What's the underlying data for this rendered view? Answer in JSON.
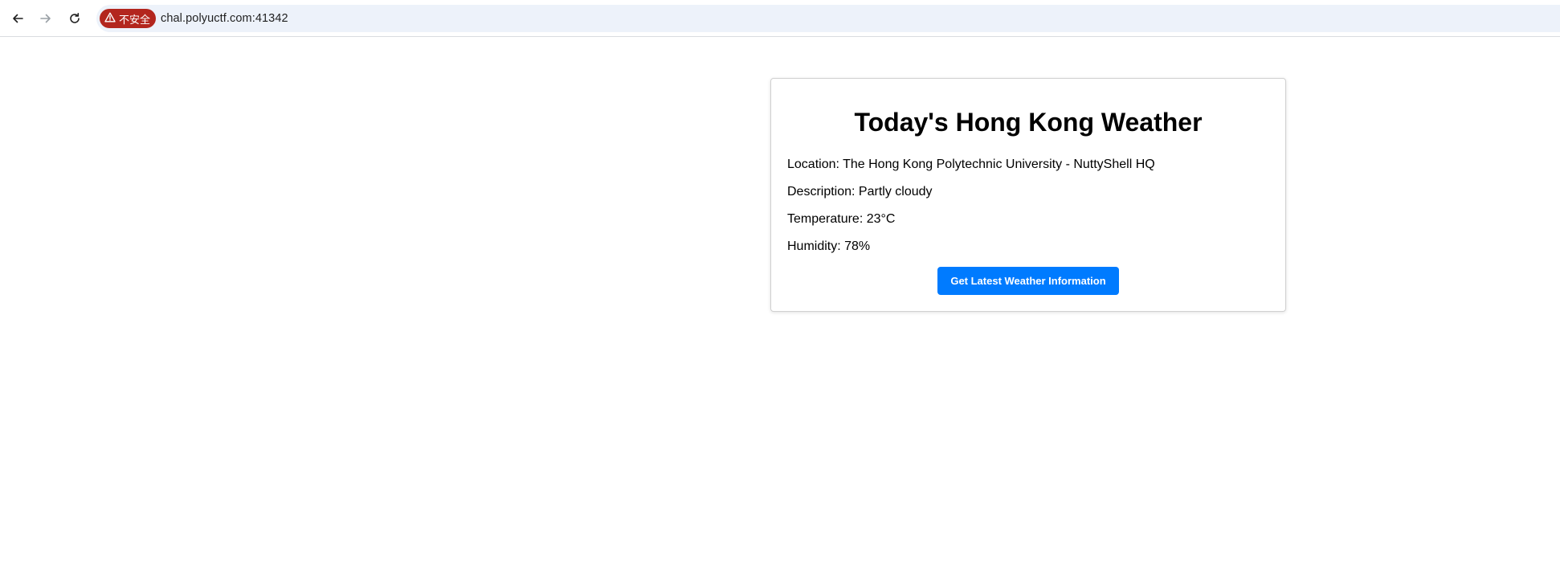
{
  "browser": {
    "security_label": "不安全",
    "url": "chal.polyuctf.com:41342",
    "icons": {
      "back": "back-arrow-icon",
      "forward": "forward-arrow-icon",
      "reload": "reload-icon",
      "warning": "warning-triangle-icon"
    },
    "colors": {
      "security_chip": "#b3261e",
      "omnibox_bg": "#edf2fa"
    }
  },
  "weather": {
    "title": "Today's Hong Kong Weather",
    "location_label": "Location: ",
    "location": "The Hong Kong Polytechnic University - NuttyShell HQ",
    "description_label": "Description: ",
    "description": "Partly cloudy",
    "temperature_label": "Temperature: ",
    "temperature": "23°C",
    "humidity_label": "Humidity: ",
    "humidity": "78%",
    "button_label": "Get Latest Weather Information",
    "button_color": "#007bff"
  }
}
